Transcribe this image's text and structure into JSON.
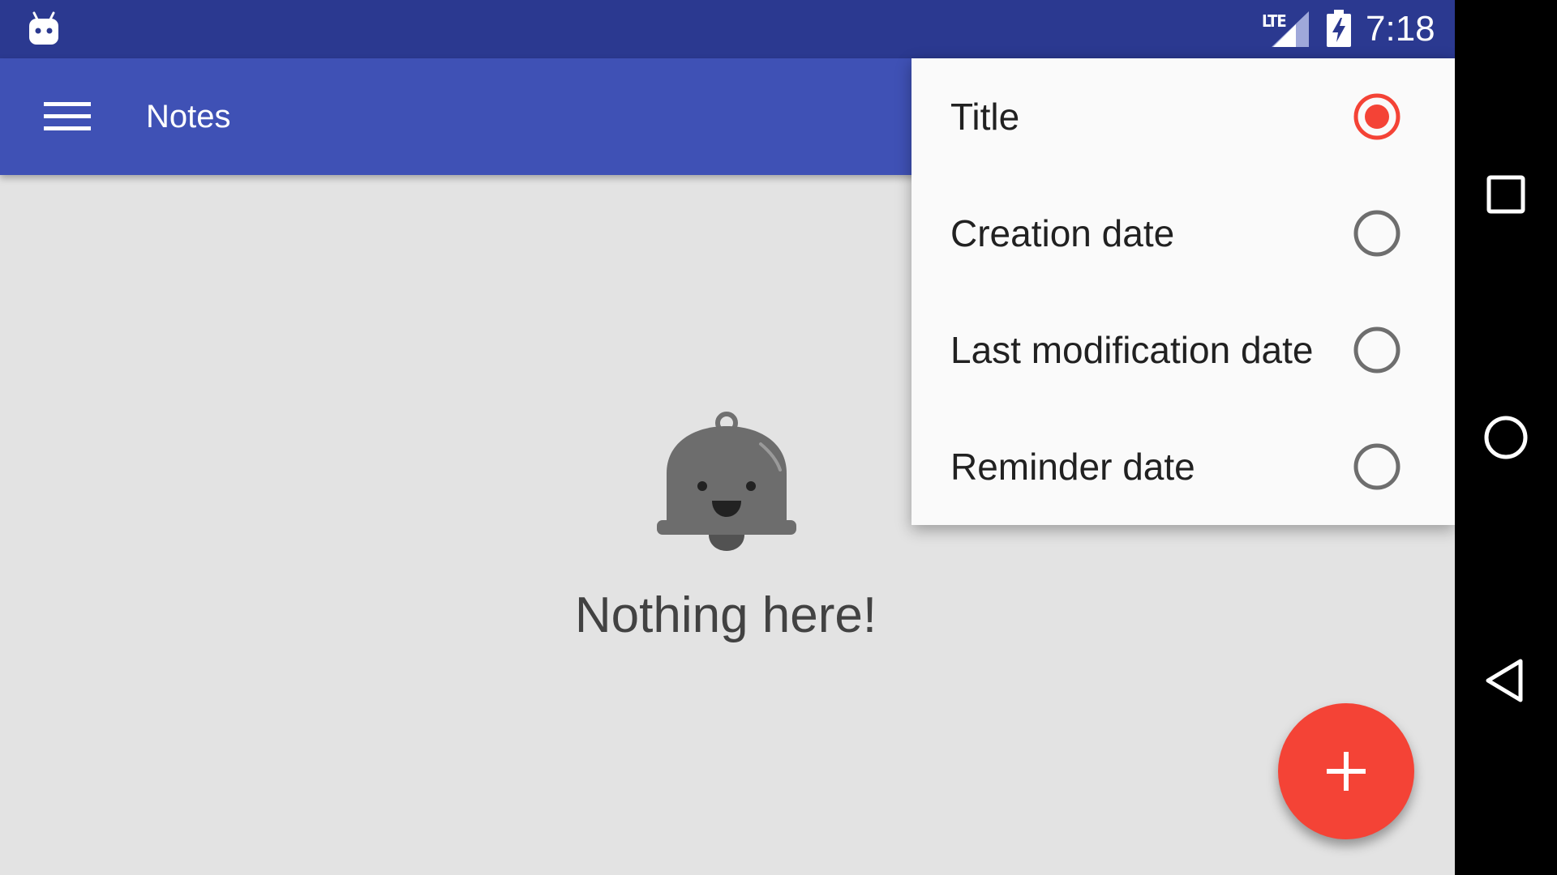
{
  "status_bar": {
    "network_label": "LTE",
    "time": "7:18",
    "app_icon": "android-robot-icon",
    "signal_icon": "cell-signal-icon",
    "battery_icon": "battery-charging-icon"
  },
  "app_bar": {
    "title": "Notes",
    "menu_icon": "hamburger-menu-icon"
  },
  "empty_state": {
    "icon": "smiling-bell-icon",
    "message": "Nothing here!"
  },
  "fab": {
    "icon": "plus-icon"
  },
  "sort_menu": {
    "items": [
      {
        "label": "Title",
        "selected": true
      },
      {
        "label": "Creation date",
        "selected": false
      },
      {
        "label": "Last modification date",
        "selected": false
      },
      {
        "label": "Reminder date",
        "selected": false
      }
    ]
  },
  "nav_bar": {
    "recents_icon": "square-recents-icon",
    "home_icon": "circle-home-icon",
    "back_icon": "triangle-back-icon"
  },
  "colors": {
    "primary": "#3f51b5",
    "primary_dark": "#2b3990",
    "accent": "#f44336",
    "background": "#e3e3e3",
    "menu_background": "#fafafa"
  }
}
